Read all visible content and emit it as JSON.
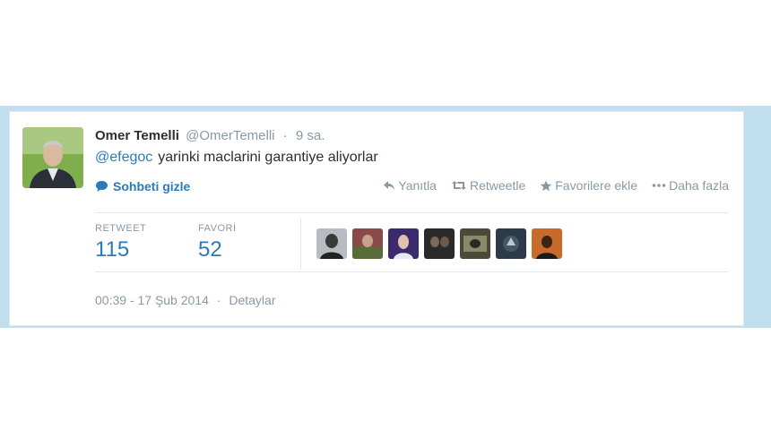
{
  "tweet": {
    "fullname": "Omer Temelli",
    "username": "@OmerTemelli",
    "separator": "·",
    "time": "9 sa.",
    "mention": "@efegoc",
    "text": "yarinki maclarini garantiye aliyorlar",
    "conversation_label": "Sohbeti gizle",
    "actions": {
      "reply": "Yanıtla",
      "retweet": "Retweetle",
      "favorite": "Favorilere ekle",
      "more": "Daha fazla"
    },
    "stats": {
      "retweet_label": "RETWEET",
      "retweet_count": "115",
      "favorite_label": "FAVORİ",
      "favorite_count": "52"
    },
    "footer": {
      "timestamp": "00:39 - 17 Şub 2014",
      "separator": "·",
      "details": "Detaylar"
    }
  },
  "colors": {
    "accent": "#2b7bb9",
    "muted": "#8899a6",
    "background_strip": "#c0deed"
  },
  "icons": [
    "reply-icon",
    "retweet-icon",
    "star-icon",
    "more-icon",
    "speech-bubble-icon"
  ]
}
